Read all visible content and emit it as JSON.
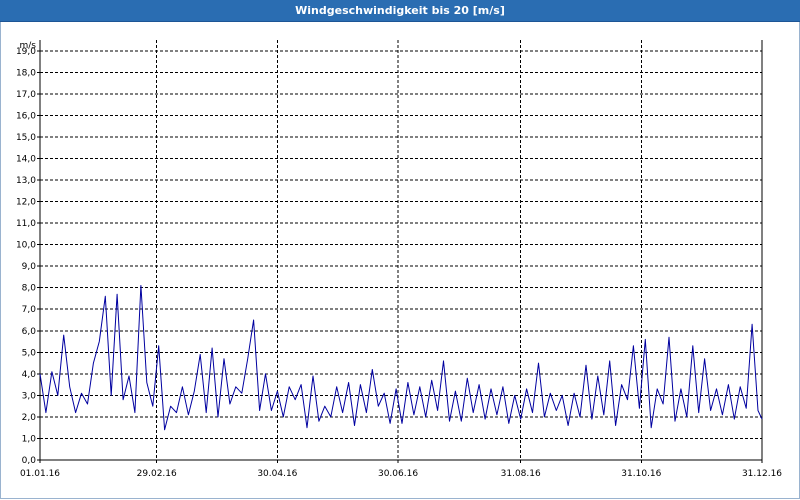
{
  "window": {
    "title": "Windgeschwindigkeit bis 20 [m/s]"
  },
  "chart_data": {
    "type": "line",
    "title": "Windgeschwindigkeit bis 20 [m/s]",
    "ylabel": "m/s",
    "xlabel": "",
    "xlim": [
      "2016-01-01",
      "2016-12-31"
    ],
    "ylim": [
      0,
      19.5
    ],
    "grid": true,
    "x_ticks": [
      "01.01.16",
      "29.02.16",
      "30.04.16",
      "30.06.16",
      "31.08.16",
      "31.10.16",
      "31.12.16"
    ],
    "y_ticks": [
      "0,0",
      "1,0",
      "2,0",
      "3,0",
      "4,0",
      "5,0",
      "6,0",
      "7,0",
      "8,0",
      "9,0",
      "10,0",
      "11,0",
      "12,0",
      "13,0",
      "14,0",
      "15,0",
      "16,0",
      "17,0",
      "18,0",
      "19,0"
    ],
    "colors": {
      "series": "#0000a0",
      "grid": "#000000",
      "titlebar": "#2a6db2"
    },
    "series": [
      {
        "x": [
          "2016-01-01",
          "2016-01-04",
          "2016-01-07",
          "2016-01-10",
          "2016-01-13",
          "2016-01-16",
          "2016-01-19",
          "2016-01-22",
          "2016-01-25",
          "2016-01-28",
          "2016-01-31",
          "2016-02-03",
          "2016-02-06",
          "2016-02-09",
          "2016-02-12",
          "2016-02-15",
          "2016-02-18",
          "2016-02-21",
          "2016-02-24",
          "2016-02-27",
          "2016-03-01",
          "2016-03-04",
          "2016-03-07",
          "2016-03-10",
          "2016-03-13",
          "2016-03-16",
          "2016-03-19",
          "2016-03-22",
          "2016-03-25",
          "2016-03-28",
          "2016-03-31",
          "2016-04-03",
          "2016-04-06",
          "2016-04-09",
          "2016-04-12",
          "2016-04-15",
          "2016-04-18",
          "2016-04-21",
          "2016-04-24",
          "2016-04-27",
          "2016-04-30",
          "2016-05-03",
          "2016-05-06",
          "2016-05-09",
          "2016-05-12",
          "2016-05-15",
          "2016-05-18",
          "2016-05-21",
          "2016-05-24",
          "2016-05-27",
          "2016-05-30",
          "2016-06-02",
          "2016-06-05",
          "2016-06-08",
          "2016-06-11",
          "2016-06-14",
          "2016-06-17",
          "2016-06-20",
          "2016-06-23",
          "2016-06-26",
          "2016-06-29",
          "2016-07-02",
          "2016-07-05",
          "2016-07-08",
          "2016-07-11",
          "2016-07-14",
          "2016-07-17",
          "2016-07-20",
          "2016-07-23",
          "2016-07-26",
          "2016-07-29",
          "2016-08-01",
          "2016-08-04",
          "2016-08-07",
          "2016-08-10",
          "2016-08-13",
          "2016-08-16",
          "2016-08-19",
          "2016-08-22",
          "2016-08-25",
          "2016-08-28",
          "2016-08-31",
          "2016-09-03",
          "2016-09-06",
          "2016-09-09",
          "2016-09-12",
          "2016-09-15",
          "2016-09-18",
          "2016-09-21",
          "2016-09-24",
          "2016-09-27",
          "2016-09-30",
          "2016-10-03",
          "2016-10-06",
          "2016-10-09",
          "2016-10-12",
          "2016-10-15",
          "2016-10-18",
          "2016-10-21",
          "2016-10-24",
          "2016-10-27",
          "2016-10-30",
          "2016-11-02",
          "2016-11-05",
          "2016-11-08",
          "2016-11-11",
          "2016-11-14",
          "2016-11-17",
          "2016-11-20",
          "2016-11-23",
          "2016-11-26",
          "2016-11-29",
          "2016-12-02",
          "2016-12-05",
          "2016-12-08",
          "2016-12-11",
          "2016-12-14",
          "2016-12-17",
          "2016-12-20",
          "2016-12-23",
          "2016-12-26",
          "2016-12-29",
          "2016-12-31"
        ],
        "values": [
          4.0,
          2.2,
          4.1,
          3.0,
          5.8,
          3.4,
          2.2,
          3.1,
          2.6,
          4.5,
          5.5,
          7.6,
          3.0,
          7.7,
          2.8,
          3.9,
          2.2,
          8.1,
          3.6,
          2.5,
          5.3,
          1.4,
          2.5,
          2.2,
          3.4,
          2.1,
          3.2,
          4.9,
          2.2,
          5.2,
          2.0,
          4.7,
          2.6,
          3.4,
          3.1,
          4.7,
          6.5,
          2.3,
          4.0,
          2.3,
          3.2,
          2.0,
          3.4,
          2.8,
          3.5,
          1.5,
          3.9,
          1.8,
          2.5,
          2.0,
          3.4,
          2.2,
          3.6,
          1.6,
          3.5,
          2.2,
          4.2,
          2.5,
          3.1,
          1.7,
          3.3,
          1.7,
          3.6,
          2.1,
          3.4,
          2.0,
          3.7,
          2.3,
          4.6,
          1.8,
          3.2,
          1.8,
          3.8,
          2.2,
          3.5,
          1.9,
          3.3,
          2.1,
          3.4,
          1.7,
          3.0,
          1.9,
          3.3,
          2.2,
          4.5,
          2.0,
          3.1,
          2.3,
          3.0,
          1.6,
          3.1,
          2.0,
          4.4,
          1.9,
          3.9,
          2.1,
          4.6,
          1.6,
          3.5,
          2.8,
          5.3,
          2.4,
          5.6,
          1.5,
          3.3,
          2.6,
          5.7,
          1.8,
          3.3,
          2.0,
          5.3,
          2.2,
          4.7,
          2.3,
          3.3,
          2.1,
          3.5,
          1.9,
          3.4,
          2.4,
          6.3,
          2.3,
          1.9
        ]
      }
    ]
  }
}
